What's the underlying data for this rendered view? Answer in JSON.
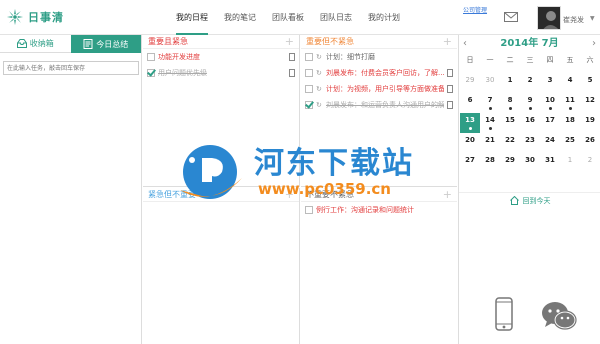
{
  "app": {
    "name": "日事清"
  },
  "nav": {
    "items": [
      {
        "label": "我的日程",
        "active": true
      },
      {
        "label": "我的笔记",
        "active": false
      },
      {
        "label": "团队看板",
        "active": false
      },
      {
        "label": "团队日志",
        "active": false
      },
      {
        "label": "我的计划",
        "active": false
      }
    ],
    "company_link": "公司管理"
  },
  "user": {
    "name": "崔尧发"
  },
  "left": {
    "tabs": {
      "inbox": "收纳箱",
      "today": "今日总结"
    },
    "input_placeholder": "在此输入任务，敲击回车保存"
  },
  "quadrants": {
    "important_urgent": {
      "title": "重要且紧急",
      "tasks": [
        {
          "text": "功能开发进度",
          "done": false,
          "style": "red",
          "note": true
        },
        {
          "text": "用户问题优先级",
          "done": true,
          "style": "done",
          "note": true
        }
      ]
    },
    "important_not_urgent": {
      "title": "重要但不紧急",
      "tasks": [
        {
          "text": "计划：细节打磨",
          "done": false,
          "style": "grey",
          "note": false,
          "bell": true
        },
        {
          "text": "刘晨发布：付费会员客户回访，了解...",
          "done": false,
          "style": "red",
          "note": true,
          "bell": true
        },
        {
          "text": "计划：为视频，用户引导等方面做准备",
          "done": false,
          "style": "red",
          "note": true,
          "bell": true
        },
        {
          "text": "刘晨发布：和运营负责人沟通用户的解决...",
          "done": true,
          "style": "done",
          "note": true,
          "bell": true
        }
      ]
    },
    "urgent_not_important": {
      "title": "紧急但不重要",
      "tasks": []
    },
    "not_urgent_not_important": {
      "title": "不重要不紧急",
      "tasks": [
        {
          "text": "例行工作：沟通记录和问题统计",
          "done": false,
          "style": "red",
          "note": false
        }
      ]
    }
  },
  "calendar": {
    "title": "2014年 7月",
    "weekdays": [
      "日",
      "一",
      "二",
      "三",
      "四",
      "五",
      "六"
    ],
    "days": [
      {
        "d": "29",
        "other": true,
        "dot": false
      },
      {
        "d": "30",
        "other": true,
        "dot": false
      },
      {
        "d": "1",
        "dot": false
      },
      {
        "d": "2",
        "dot": false
      },
      {
        "d": "3",
        "dot": false
      },
      {
        "d": "4",
        "dot": false
      },
      {
        "d": "5",
        "dot": false
      },
      {
        "d": "6",
        "dot": false
      },
      {
        "d": "7",
        "dot": true
      },
      {
        "d": "8",
        "dot": true
      },
      {
        "d": "9",
        "dot": true
      },
      {
        "d": "10",
        "dot": true
      },
      {
        "d": "11",
        "dot": true
      },
      {
        "d": "12",
        "dot": false
      },
      {
        "d": "13",
        "today": true,
        "dot": true
      },
      {
        "d": "14",
        "dot": true
      },
      {
        "d": "15",
        "dot": false
      },
      {
        "d": "16",
        "dot": false
      },
      {
        "d": "17",
        "dot": false
      },
      {
        "d": "18",
        "dot": false
      },
      {
        "d": "19",
        "dot": false
      },
      {
        "d": "20",
        "dot": false
      },
      {
        "d": "21",
        "dot": false
      },
      {
        "d": "22",
        "dot": false
      },
      {
        "d": "23",
        "dot": false
      },
      {
        "d": "24",
        "dot": false
      },
      {
        "d": "25",
        "dot": false
      },
      {
        "d": "26",
        "dot": false
      },
      {
        "d": "27",
        "dot": false
      },
      {
        "d": "28",
        "dot": false
      },
      {
        "d": "29",
        "dot": false
      },
      {
        "d": "30",
        "dot": false
      },
      {
        "d": "31",
        "dot": false
      },
      {
        "d": "1",
        "other": true,
        "dot": false
      },
      {
        "d": "2",
        "other": true,
        "dot": false
      }
    ],
    "back_to_today": "回到今天"
  },
  "watermark": {
    "title": "河东下载站",
    "url": "www.pc0359.cn"
  },
  "colors": {
    "accent": "#2e9e86",
    "red_task": "#e23c3c",
    "orange_head": "#f0883a",
    "blue_head": "#4aa3df"
  }
}
